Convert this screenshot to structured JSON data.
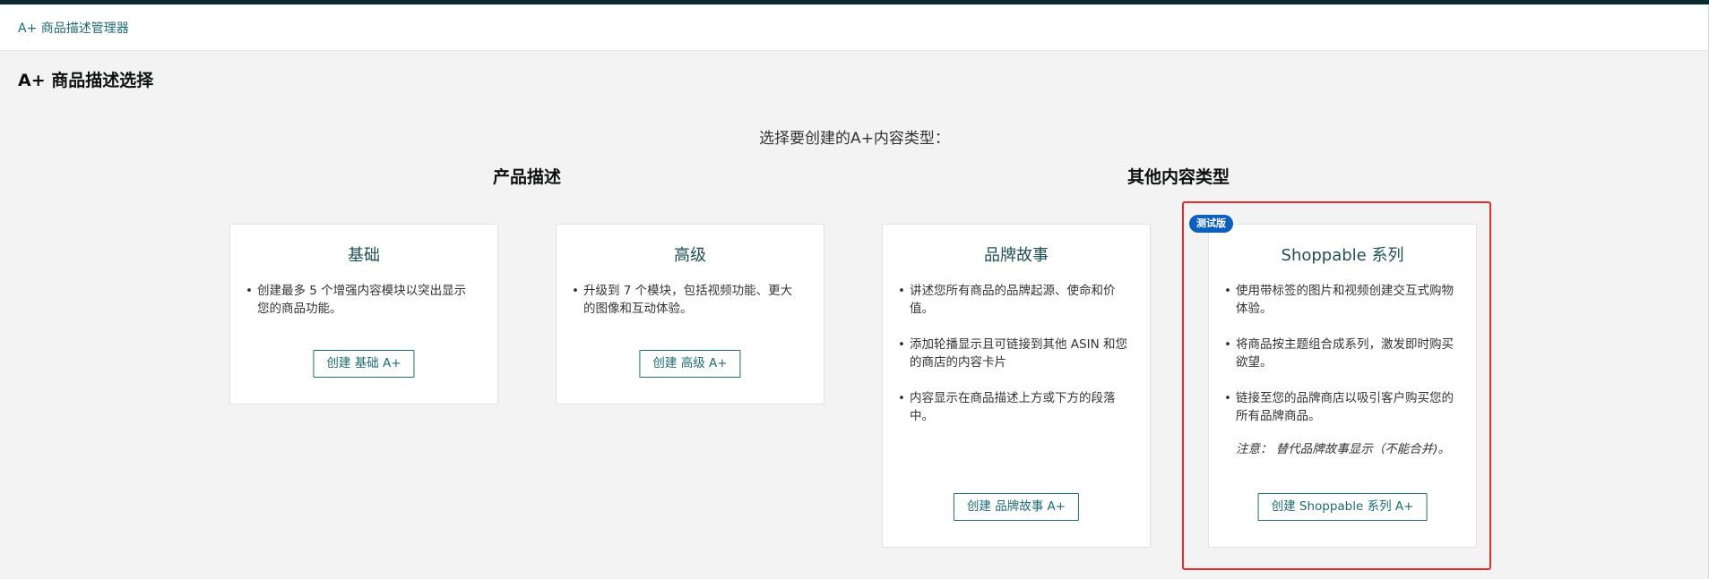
{
  "breadcrumb": "A+ 商品描述管理器",
  "page_title": "A+ 商品描述选择",
  "prompt": "选择要创建的A+内容类型：",
  "sections": {
    "product": "产品描述",
    "other": "其他内容类型"
  },
  "cards": {
    "basic": {
      "title": "基础",
      "bullets": [
        "创建最多 5 个增强内容模块以突出显示您的商品功能。"
      ],
      "button": "创建 基础 A+"
    },
    "premium": {
      "title": "高级",
      "bullets": [
        "升级到 7 个模块，包括视频功能、更大的图像和互动体验。"
      ],
      "button": "创建 高级 A+"
    },
    "brand": {
      "title": "品牌故事",
      "bullets": [
        "讲述您所有商品的品牌起源、使命和价值。",
        "添加轮播显示且可链接到其他 ASIN 和您的商店的内容卡片",
        "内容显示在商品描述上方或下方的段落中。"
      ],
      "button": "创建 品牌故事 A+"
    },
    "shoppable": {
      "badge": "测试版",
      "title": "Shoppable 系列",
      "bullets": [
        "使用带标签的图片和视频创建交互式购物体验。",
        "将商品按主题组合成系列，激发即时购买欲望。",
        "链接至您的品牌商店以吸引客户购买您的所有品牌商品。"
      ],
      "note": "注意： 替代品牌故事显示（不能合并)。",
      "button": "创建 Shoppable 系列 A+"
    }
  },
  "colors": {
    "accent": "#1e6b73",
    "highlight": "#e02d2d",
    "badge": "#0b5fbd",
    "topbar": "#0b2b2e"
  }
}
